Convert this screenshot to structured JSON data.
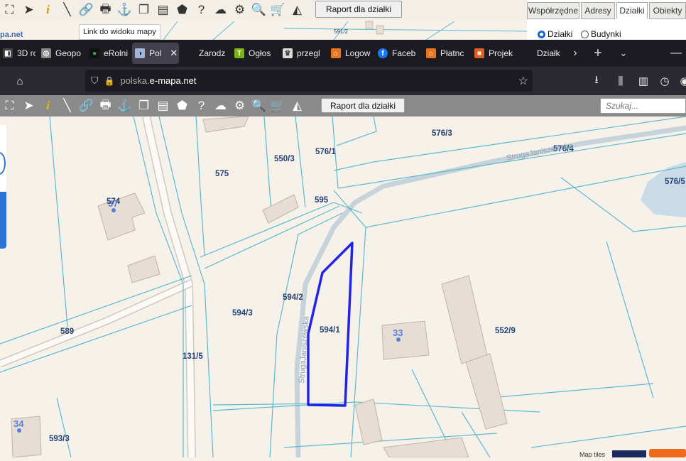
{
  "bg_app": {
    "report_button": "Raport dla działki",
    "tooltip": "Link do widoku mapy",
    "tabs": [
      "Współrzędne",
      "Adresy",
      "Działki",
      "Obiekty"
    ],
    "active_tab": "Działki",
    "radio_options": [
      "Działki",
      "Budynki"
    ],
    "map_fragment_labels": [
      "pa.net",
      "591/2"
    ]
  },
  "browser": {
    "tabs": [
      {
        "label": "3D ro",
        "icon": "cube-icon"
      },
      {
        "label": "Geopo",
        "icon": "geoportal-icon"
      },
      {
        "label": "eRolni",
        "icon": "erolnik-icon"
      },
      {
        "label": "Pol",
        "icon": "emapa-icon",
        "active": true
      },
      {
        "label": "Zarodz",
        "icon": "none"
      },
      {
        "label": "Ogłos",
        "icon": "olx-icon"
      },
      {
        "label": "przegl",
        "icon": "crest-icon"
      },
      {
        "label": "Logow",
        "icon": "home-icon"
      },
      {
        "label": "Faceb",
        "icon": "facebook-icon"
      },
      {
        "label": "Płatnc",
        "icon": "home-icon"
      },
      {
        "label": "Projek",
        "icon": "project-icon"
      },
      {
        "label": "Działk",
        "icon": "none"
      }
    ],
    "url_domain": "polska.",
    "url_host": "e-mapa.net"
  },
  "app": {
    "report_button": "Raport dla działki",
    "search_placeholder": "Szukaj..."
  },
  "map": {
    "parcels": [
      "576/3",
      "576/1",
      "576/4",
      "550/3",
      "575",
      "595",
      "576/5",
      "574",
      "594/2",
      "594/3",
      "594/1",
      "552/9",
      "589",
      "131/5",
      "593/3"
    ],
    "streets": [
      "StrugaJaniszewska",
      "StrugaJaniszewska"
    ],
    "house_numbers": [
      "37",
      "33",
      "34"
    ],
    "bottom_text": "Map tiles",
    "selected_parcel": "594/1",
    "selection_color": "#2323e8"
  }
}
